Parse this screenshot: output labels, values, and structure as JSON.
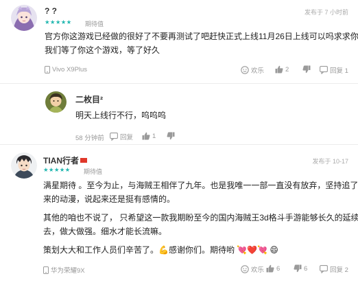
{
  "comments": [
    {
      "username": "? ?",
      "stars": "★★★★★",
      "expect_label": "期待值",
      "time": "发布于 7 小时前",
      "text_lines": [
        "官方你这游戏已经做的很好了不要再测试了吧赶快正式上线11月26日上线可以吗求求你了,",
        "我们等了你这个游戏，等了好久"
      ],
      "device": "Vivo X9Plus",
      "actions": {
        "happy": "欢乐",
        "like_count": "2",
        "dislike_count": "",
        "reply": "回复 1"
      }
    },
    {
      "username": "TIAN行者",
      "stars": "★★★★★",
      "expect_label": "期待值",
      "time": "发布于 10-17",
      "paragraphs": [
        [
          "满星期待 。至今为止，与海贼王相伴了九年。也是我唯一一部一直没有放弃，坚持追了下",
          "来的动漫，说起来还是挺有感情的。"
        ],
        [
          "其他的咱也不说了， 只希望这一款我期盼至今的国内海贼王3d格斗手游能够长久的延续下",
          "去，做大做强。细水才能长流嘛。"
        ],
        [
          "策划大大和工作人员们辛苦了。💪感谢你们。期待哟 💘❤️💘 😄"
        ]
      ],
      "device": "华为荣耀9X",
      "actions": {
        "happy": "欢乐",
        "like_count": "6",
        "dislike_count": "6",
        "reply": "回复 2"
      }
    }
  ],
  "reply": {
    "username": "二枚目²",
    "text": "明天上线行不行，呜呜呜",
    "time": "58 分钟前",
    "reply_label": "回复",
    "like_count": "1"
  },
  "colors": {
    "star": "#22b7b0",
    "muted": "#999999",
    "divider": "#ececec"
  }
}
